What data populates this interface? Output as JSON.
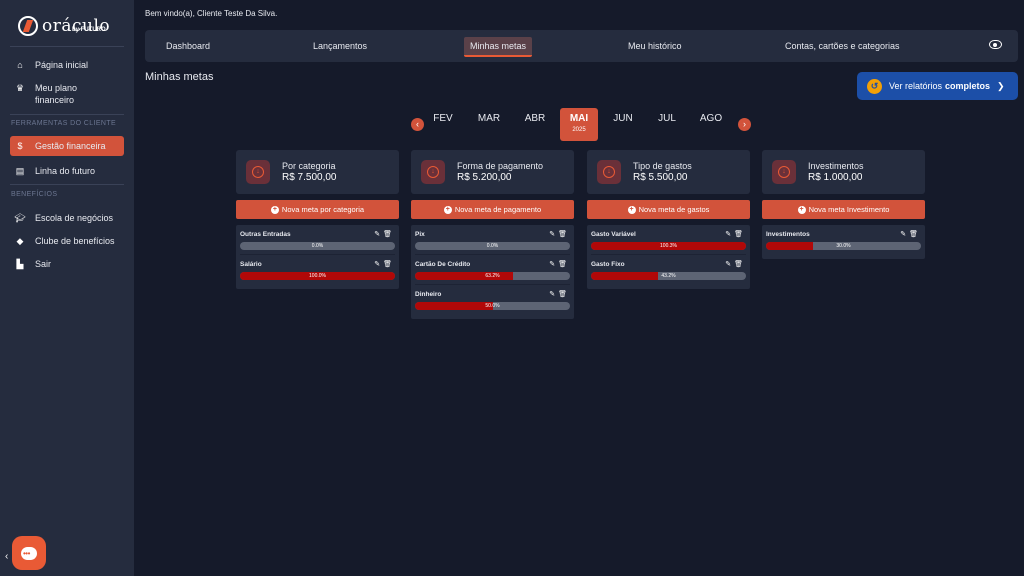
{
  "brand": {
    "name": "oráculo",
    "sub": "by FUTURO"
  },
  "sidebar": {
    "items": [
      {
        "label": "Página inicial",
        "icon": "home-icon"
      },
      {
        "label": "Meu plano financeiro",
        "icon": "crown-icon"
      }
    ],
    "section_tools": "FERRAMENTAS DO CLIENTE",
    "tools": [
      {
        "label": "Gestão financeira",
        "icon": "dollar-icon",
        "active": true
      },
      {
        "label": "Linha do futuro",
        "icon": "calendar-icon"
      }
    ],
    "section_benefits": "BENEFÍCIOS",
    "benefits": [
      {
        "label": "Escola de negócios",
        "icon": "graduation-cap-icon"
      },
      {
        "label": "Clube de benefícios",
        "icon": "diamond-icon"
      },
      {
        "label": "Sair",
        "icon": "logout-icon"
      }
    ]
  },
  "header": {
    "welcome": "Bem vindo(a), Cliente Teste Da Silva.",
    "tabs": [
      "Dashboard",
      "Lançamentos",
      "Minhas metas",
      "Meu histórico",
      "Contas, cartões e categorias"
    ],
    "active_tab": "Minhas metas"
  },
  "main": {
    "title": "Minhas metas",
    "report_button": {
      "prefix": "Ver relatórios",
      "bold": "completos"
    },
    "months": [
      "FEV",
      "MAR",
      "ABR",
      "MAI",
      "JUN",
      "JUL",
      "AGO"
    ],
    "active_month": "MAI",
    "year": "2025",
    "columns": [
      {
        "title": "Por categoria",
        "value": "R$ 7.500,00",
        "button": "Nova meta por categoria",
        "goals": [
          {
            "name": "Outras Entradas",
            "label": "0.0%",
            "pct": 0
          },
          {
            "name": "Salário",
            "label": "100.0%",
            "pct": 100
          }
        ]
      },
      {
        "title": "Forma de pagamento",
        "value": "R$ 5.200,00",
        "button": "Nova meta de pagamento",
        "goals": [
          {
            "name": "Pix",
            "label": "0.0%",
            "pct": 0
          },
          {
            "name": "Cartão De Crédito",
            "label": "63.2%",
            "pct": 63.2
          },
          {
            "name": "Dinheiro",
            "label": "50.0%",
            "pct": 50
          }
        ]
      },
      {
        "title": "Tipo de gastos",
        "value": "R$ 5.500,00",
        "button": "Nova meta de gastos",
        "goals": [
          {
            "name": "Gasto Variável",
            "label": "100.3%",
            "pct": 100
          },
          {
            "name": "Gasto Fixo",
            "label": "43.2%",
            "pct": 43.2
          }
        ]
      },
      {
        "title": "Investimentos",
        "value": "R$ 1.000,00",
        "button": "Nova meta Investimento",
        "goals": [
          {
            "name": "Investimentos",
            "label": "30.0%",
            "pct": 30
          }
        ]
      }
    ]
  },
  "colors": {
    "accent": "#d2533b",
    "progress": "#b10808",
    "background": "#151a2a",
    "panel": "#252c3e",
    "report": "#1c4fa8"
  }
}
